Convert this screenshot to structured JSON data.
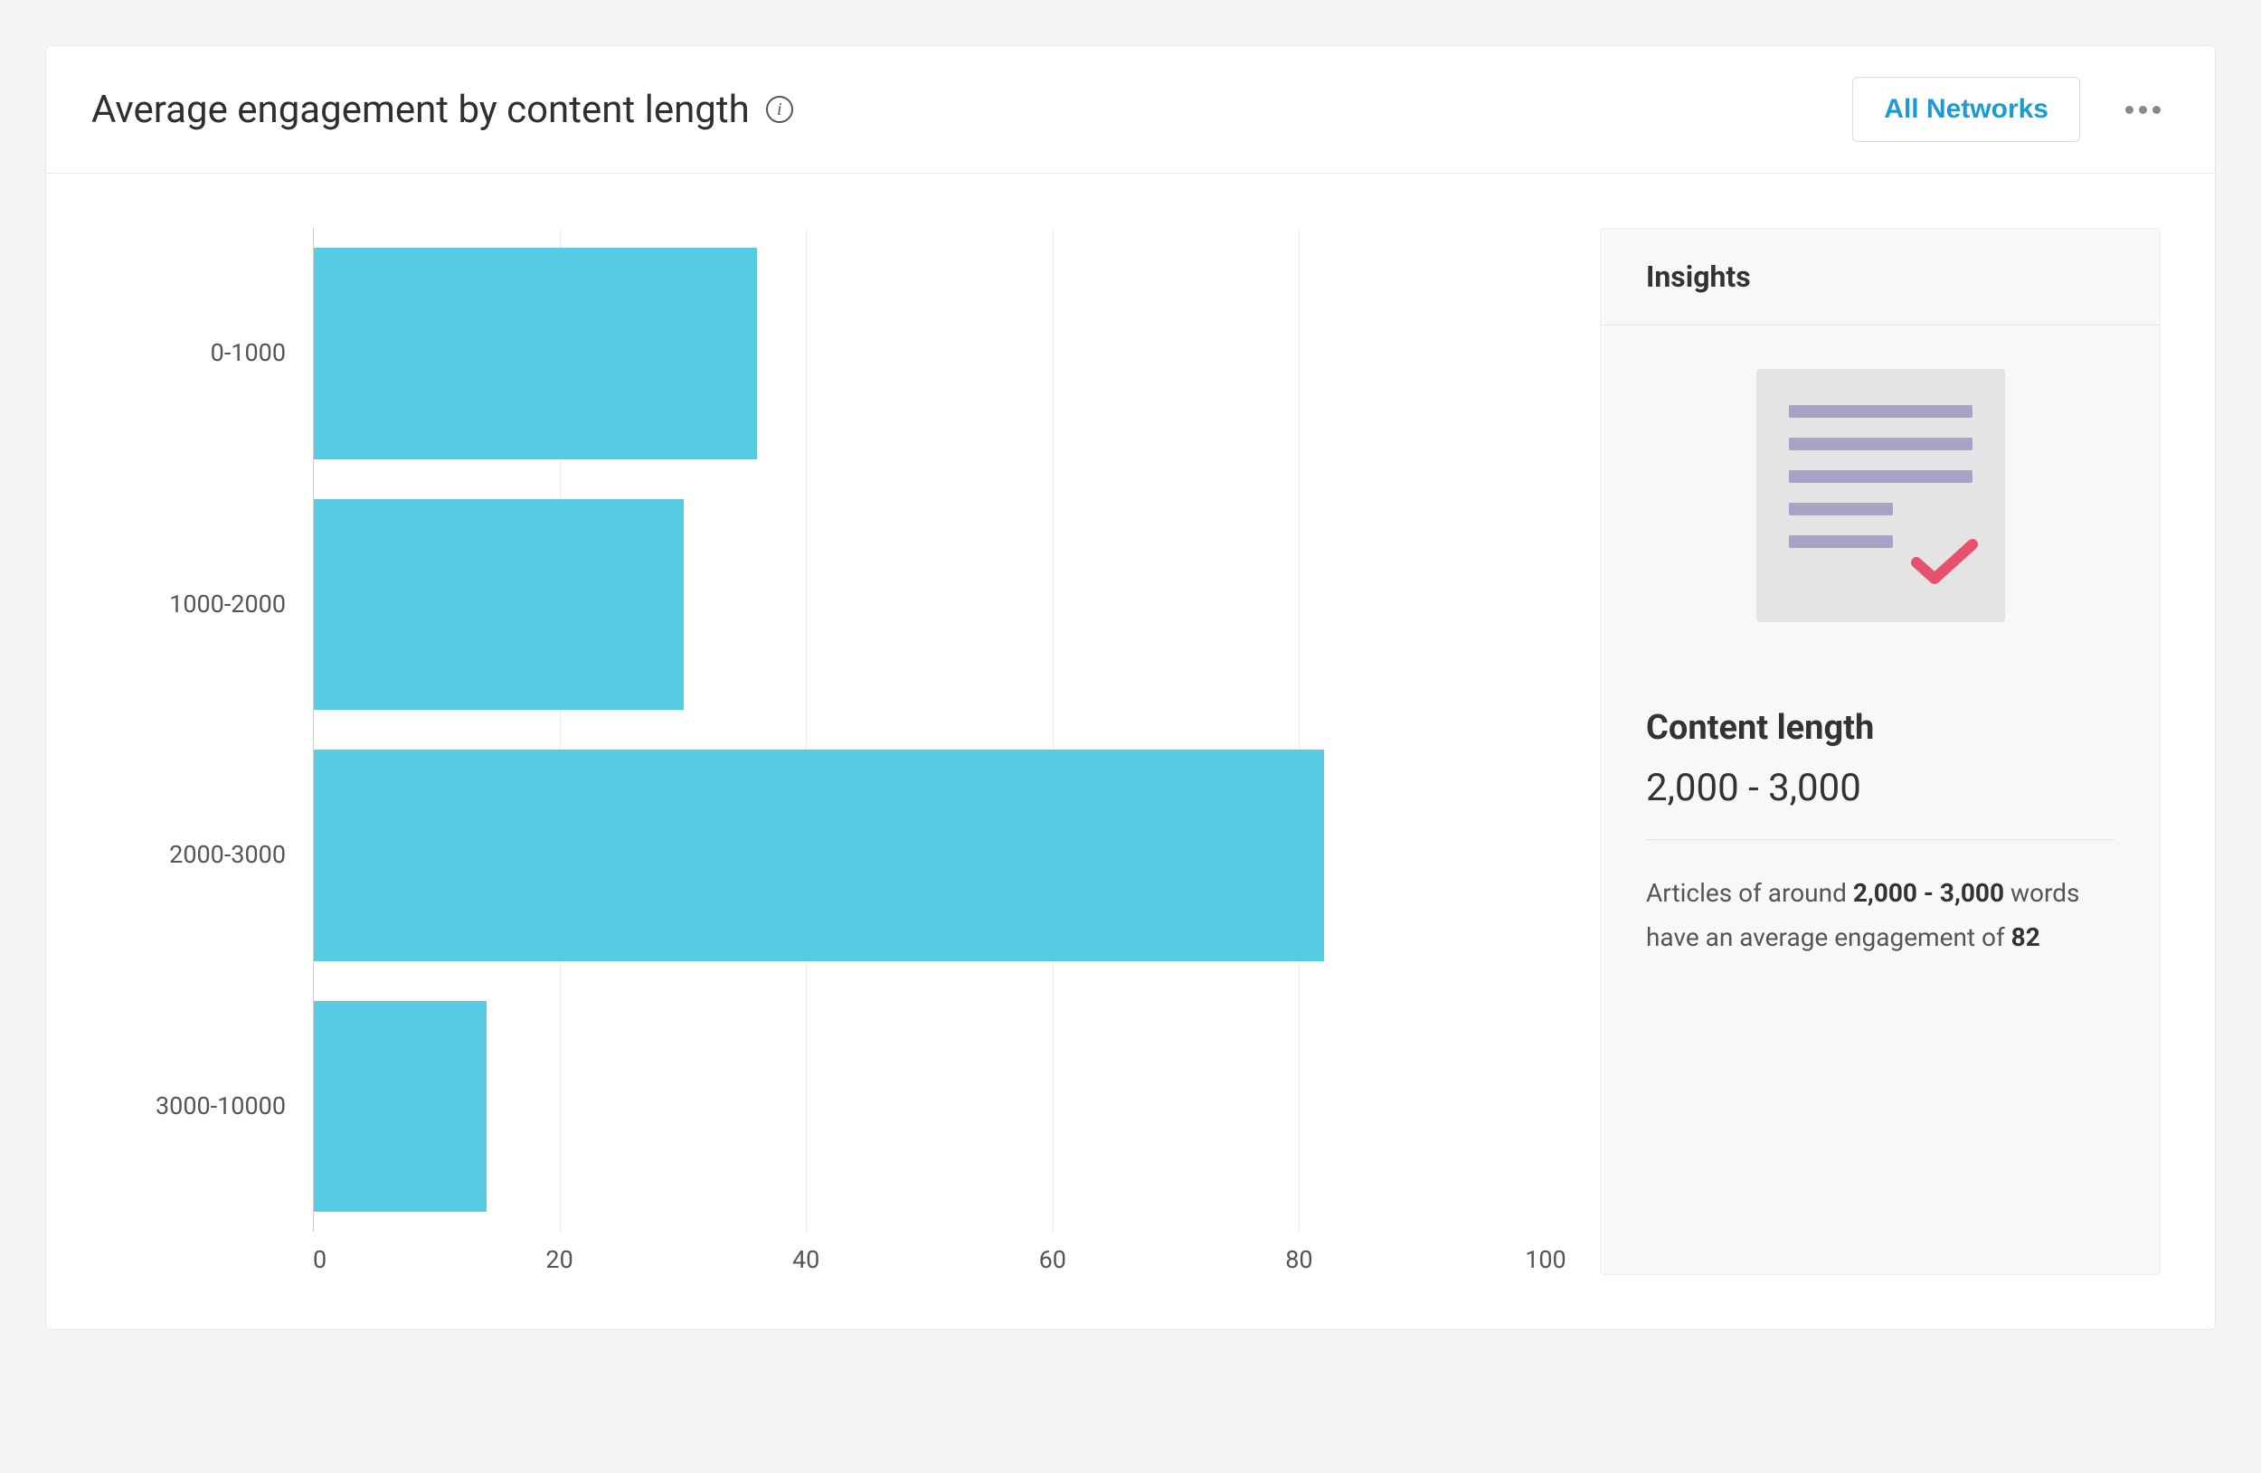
{
  "header": {
    "title": "Average engagement by content length",
    "info_icon": "info-icon",
    "dropdown_label": "All Networks"
  },
  "chart_data": {
    "type": "bar",
    "orientation": "horizontal",
    "categories": [
      "0-1000",
      "1000-2000",
      "2000-3000",
      "3000-10000"
    ],
    "values": [
      36,
      30,
      82,
      14
    ],
    "title": "Average engagement by content length",
    "xlabel": "",
    "ylabel": "",
    "xlim": [
      0,
      100
    ],
    "x_ticks": [
      0,
      20,
      40,
      60,
      80,
      100
    ],
    "bar_color": "#56cce2"
  },
  "insights": {
    "panel_title": "Insights",
    "metric_label": "Content length",
    "metric_value": "2,000 - 3,000",
    "description_prefix": "Articles of around ",
    "description_bold1": "2,000 - 3,000",
    "description_mid": " words have an average engagement of ",
    "description_bold2": "82"
  }
}
